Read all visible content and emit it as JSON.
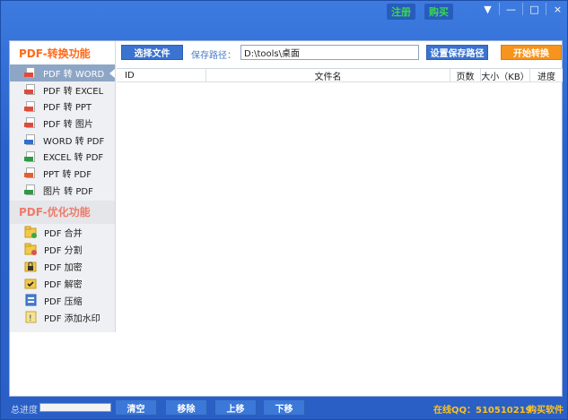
{
  "titlebar": {
    "register": "注册",
    "buy": "购买",
    "controls": {
      "menu": "▼",
      "minimize": "—",
      "maximize": "□",
      "close": "×"
    }
  },
  "toolbar": {
    "select_file": "选择文件",
    "save_path_label": "保存路径：",
    "save_path_value": "D:\\tools\\桌面",
    "set_save_path": "设置保存路径",
    "start_convert": "开始转换"
  },
  "sidebar": {
    "section1_title": "PDF-转换功能",
    "convert_items": [
      {
        "label": "PDF 转 WORD",
        "icon": "pdf-file-icon",
        "tag_color": "#e04a3c",
        "active": true
      },
      {
        "label": "PDF 转 EXCEL",
        "icon": "pdf-file-icon",
        "tag_color": "#e04a3c"
      },
      {
        "label": "PDF 转 PPT",
        "icon": "pdf-file-icon",
        "tag_color": "#e04a3c"
      },
      {
        "label": "PDF 转 图片",
        "icon": "pdf-file-icon",
        "tag_color": "#e04a3c"
      },
      {
        "label": "WORD 转 PDF",
        "icon": "word-file-icon",
        "tag_color": "#2f6fcf"
      },
      {
        "label": "EXCEL 转 PDF",
        "icon": "excel-file-icon",
        "tag_color": "#2e9a45"
      },
      {
        "label": "PPT 转 PDF",
        "icon": "ppt-file-icon",
        "tag_color": "#e0612f"
      },
      {
        "label": "图片 转 PDF",
        "icon": "image-file-icon",
        "tag_color": "#2e9a45"
      }
    ],
    "section2_title": "PDF-优化功能",
    "optimize_items": [
      {
        "label": "PDF 合并",
        "icon": "merge-folder-icon"
      },
      {
        "label": "PDF 分割",
        "icon": "split-folder-icon"
      },
      {
        "label": "PDF 加密",
        "icon": "lock-folder-icon"
      },
      {
        "label": "PDF 解密",
        "icon": "unlock-folder-icon"
      },
      {
        "label": "PDF 压缩",
        "icon": "compress-icon"
      },
      {
        "label": "PDF 添加水印",
        "icon": "watermark-icon"
      }
    ]
  },
  "table": {
    "columns": [
      "ID",
      "文件名",
      "页数",
      "大小（KB）",
      "进度"
    ],
    "rows": []
  },
  "bottom": {
    "progress_label": "总进度",
    "progress_value": 0,
    "clear": "清空",
    "remove": "移除",
    "move_up": "上移",
    "move_down": "下移",
    "qq": "在线QQ：510510219",
    "buy_software": "购买软件"
  },
  "colors": {
    "window_blue": "#2a62cc",
    "accent_orange": "#f7941d",
    "link_green": "#39d84a",
    "qq_yellow": "#ffc21a"
  }
}
